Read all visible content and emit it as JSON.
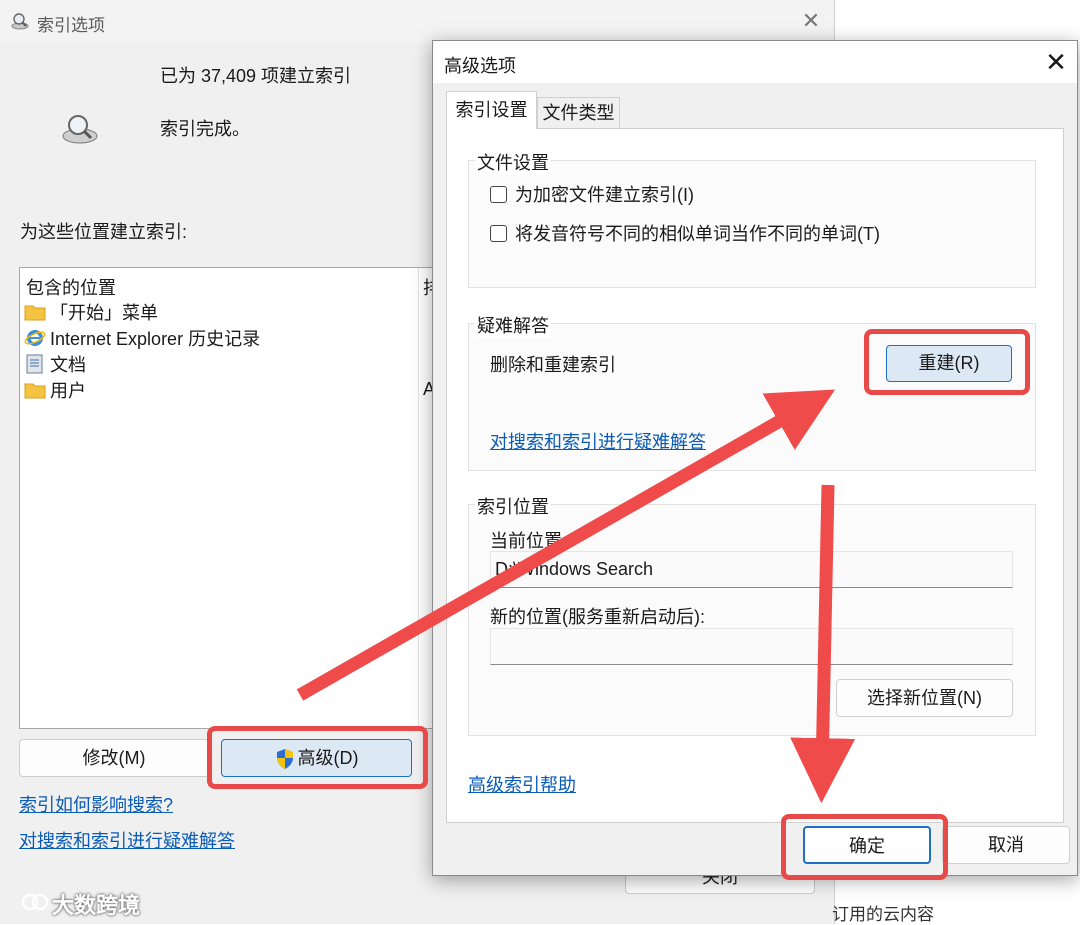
{
  "bg_dialog": {
    "title": "索引选项",
    "count_text": "已为 37,409 项建立索引",
    "status_text": "索引完成。",
    "locations_label": "为这些位置建立索引:",
    "list_header": "包含的位置",
    "list_header_col2": "排",
    "locations": [
      {
        "label": "「开始」菜单",
        "icon": "folder-icon",
        "extra": ""
      },
      {
        "label": "Internet Explorer 历史记录",
        "icon": "internet-explorer-icon",
        "extra": ""
      },
      {
        "label": "文档",
        "icon": "document-icon",
        "extra": ""
      },
      {
        "label": "用户",
        "icon": "folder-icon",
        "extra": "A"
      }
    ],
    "modify_button": "修改(M)",
    "advanced_button": "高级(D)",
    "close_button": "关闭",
    "link_how_indexing": "索引如何影响搜索?",
    "link_troubleshoot": "对搜索和索引进行疑难解答",
    "cloud_text": "订用的云内容"
  },
  "fg_dialog": {
    "title": "高级选项",
    "tabs": [
      "索引设置",
      "文件类型"
    ],
    "file_settings": {
      "title": "文件设置",
      "options": [
        "为加密文件建立索引(I)",
        "将发音符号不同的相似单词当作不同的单词(T)"
      ]
    },
    "troubleshooting": {
      "title": "疑难解答",
      "rebuild_label": "删除和重建索引",
      "rebuild_button": "重建(R)",
      "link": "对搜索和索引进行疑难解答"
    },
    "index_location": {
      "title": "索引位置",
      "current_label": "当前位置:",
      "current_value": "D:\\Windows Search",
      "new_label": "新的位置(服务重新启动后):",
      "new_value": "",
      "select_button": "选择新位置(N)"
    },
    "help_link": "高级索引帮助",
    "ok_button": "确定",
    "cancel_button": "取消"
  },
  "watermark": "大数跨境",
  "colors": {
    "highlight": "#e84a4a",
    "link": "#0a5bb8",
    "accent": "#1f6fc4"
  }
}
